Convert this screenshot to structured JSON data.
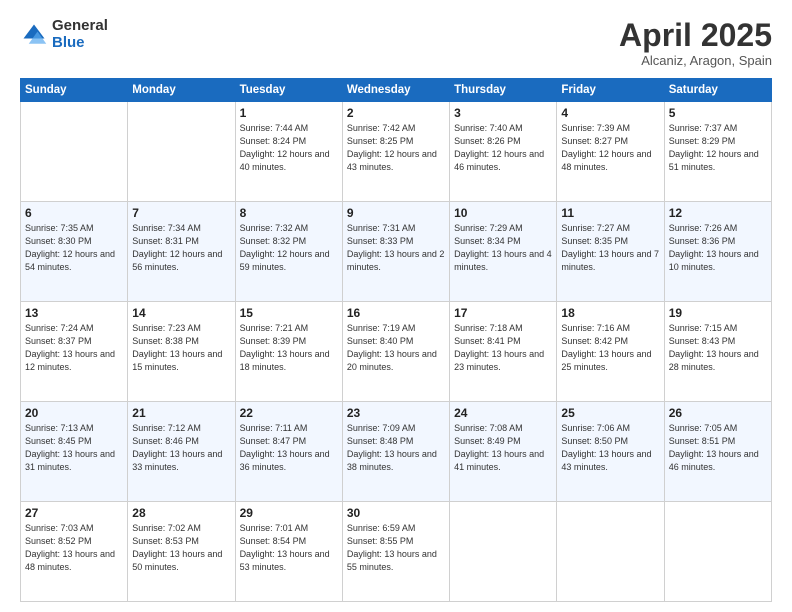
{
  "logo": {
    "general": "General",
    "blue": "Blue"
  },
  "header": {
    "month": "April 2025",
    "location": "Alcaniz, Aragon, Spain"
  },
  "weekdays": [
    "Sunday",
    "Monday",
    "Tuesday",
    "Wednesday",
    "Thursday",
    "Friday",
    "Saturday"
  ],
  "weeks": [
    [
      {
        "day": "",
        "info": ""
      },
      {
        "day": "",
        "info": ""
      },
      {
        "day": "1",
        "info": "Sunrise: 7:44 AM\nSunset: 8:24 PM\nDaylight: 12 hours and 40 minutes."
      },
      {
        "day": "2",
        "info": "Sunrise: 7:42 AM\nSunset: 8:25 PM\nDaylight: 12 hours and 43 minutes."
      },
      {
        "day": "3",
        "info": "Sunrise: 7:40 AM\nSunset: 8:26 PM\nDaylight: 12 hours and 46 minutes."
      },
      {
        "day": "4",
        "info": "Sunrise: 7:39 AM\nSunset: 8:27 PM\nDaylight: 12 hours and 48 minutes."
      },
      {
        "day": "5",
        "info": "Sunrise: 7:37 AM\nSunset: 8:29 PM\nDaylight: 12 hours and 51 minutes."
      }
    ],
    [
      {
        "day": "6",
        "info": "Sunrise: 7:35 AM\nSunset: 8:30 PM\nDaylight: 12 hours and 54 minutes."
      },
      {
        "day": "7",
        "info": "Sunrise: 7:34 AM\nSunset: 8:31 PM\nDaylight: 12 hours and 56 minutes."
      },
      {
        "day": "8",
        "info": "Sunrise: 7:32 AM\nSunset: 8:32 PM\nDaylight: 12 hours and 59 minutes."
      },
      {
        "day": "9",
        "info": "Sunrise: 7:31 AM\nSunset: 8:33 PM\nDaylight: 13 hours and 2 minutes."
      },
      {
        "day": "10",
        "info": "Sunrise: 7:29 AM\nSunset: 8:34 PM\nDaylight: 13 hours and 4 minutes."
      },
      {
        "day": "11",
        "info": "Sunrise: 7:27 AM\nSunset: 8:35 PM\nDaylight: 13 hours and 7 minutes."
      },
      {
        "day": "12",
        "info": "Sunrise: 7:26 AM\nSunset: 8:36 PM\nDaylight: 13 hours and 10 minutes."
      }
    ],
    [
      {
        "day": "13",
        "info": "Sunrise: 7:24 AM\nSunset: 8:37 PM\nDaylight: 13 hours and 12 minutes."
      },
      {
        "day": "14",
        "info": "Sunrise: 7:23 AM\nSunset: 8:38 PM\nDaylight: 13 hours and 15 minutes."
      },
      {
        "day": "15",
        "info": "Sunrise: 7:21 AM\nSunset: 8:39 PM\nDaylight: 13 hours and 18 minutes."
      },
      {
        "day": "16",
        "info": "Sunrise: 7:19 AM\nSunset: 8:40 PM\nDaylight: 13 hours and 20 minutes."
      },
      {
        "day": "17",
        "info": "Sunrise: 7:18 AM\nSunset: 8:41 PM\nDaylight: 13 hours and 23 minutes."
      },
      {
        "day": "18",
        "info": "Sunrise: 7:16 AM\nSunset: 8:42 PM\nDaylight: 13 hours and 25 minutes."
      },
      {
        "day": "19",
        "info": "Sunrise: 7:15 AM\nSunset: 8:43 PM\nDaylight: 13 hours and 28 minutes."
      }
    ],
    [
      {
        "day": "20",
        "info": "Sunrise: 7:13 AM\nSunset: 8:45 PM\nDaylight: 13 hours and 31 minutes."
      },
      {
        "day": "21",
        "info": "Sunrise: 7:12 AM\nSunset: 8:46 PM\nDaylight: 13 hours and 33 minutes."
      },
      {
        "day": "22",
        "info": "Sunrise: 7:11 AM\nSunset: 8:47 PM\nDaylight: 13 hours and 36 minutes."
      },
      {
        "day": "23",
        "info": "Sunrise: 7:09 AM\nSunset: 8:48 PM\nDaylight: 13 hours and 38 minutes."
      },
      {
        "day": "24",
        "info": "Sunrise: 7:08 AM\nSunset: 8:49 PM\nDaylight: 13 hours and 41 minutes."
      },
      {
        "day": "25",
        "info": "Sunrise: 7:06 AM\nSunset: 8:50 PM\nDaylight: 13 hours and 43 minutes."
      },
      {
        "day": "26",
        "info": "Sunrise: 7:05 AM\nSunset: 8:51 PM\nDaylight: 13 hours and 46 minutes."
      }
    ],
    [
      {
        "day": "27",
        "info": "Sunrise: 7:03 AM\nSunset: 8:52 PM\nDaylight: 13 hours and 48 minutes."
      },
      {
        "day": "28",
        "info": "Sunrise: 7:02 AM\nSunset: 8:53 PM\nDaylight: 13 hours and 50 minutes."
      },
      {
        "day": "29",
        "info": "Sunrise: 7:01 AM\nSunset: 8:54 PM\nDaylight: 13 hours and 53 minutes."
      },
      {
        "day": "30",
        "info": "Sunrise: 6:59 AM\nSunset: 8:55 PM\nDaylight: 13 hours and 55 minutes."
      },
      {
        "day": "",
        "info": ""
      },
      {
        "day": "",
        "info": ""
      },
      {
        "day": "",
        "info": ""
      }
    ]
  ]
}
